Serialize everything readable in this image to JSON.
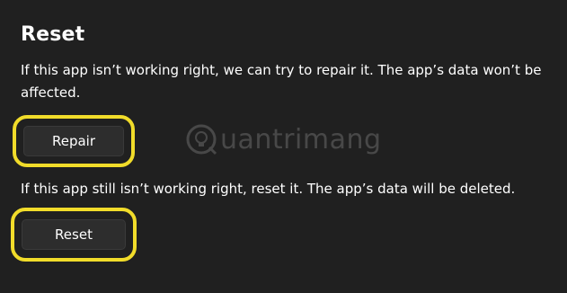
{
  "section": {
    "title": "Reset"
  },
  "repair": {
    "description": "If this app isn’t working right, we can try to repair it. The app’s data won’t be affected.",
    "button_label": "Repair"
  },
  "reset": {
    "description": "If this app still isn’t working right, reset it. The app’s data will be deleted.",
    "button_label": "Reset"
  },
  "watermark": {
    "text": "uantrimang",
    "icon": "quantrimang-logo-icon"
  },
  "colors": {
    "background": "#202020",
    "button_background": "#2d2d2d",
    "highlight": "#f1dc2a",
    "text": "#ffffff"
  }
}
